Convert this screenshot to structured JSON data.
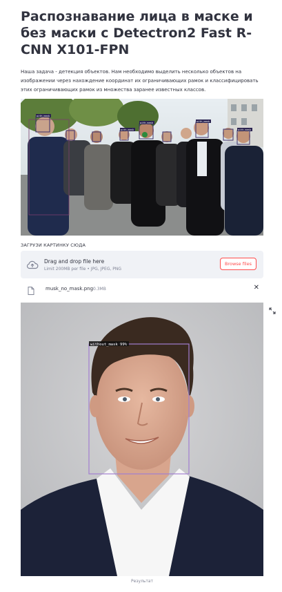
{
  "header": {
    "title": "Распознавание лица в маске и без маски с Detectron2 Fast R-CNN X101-FPN",
    "description": "Наша задача - детекция объектов. Нам необходимо выделить несколько объектов на изображении через нахождение координат их ограничивающих рамок и классифицировать этих ограничивающих рамок из множества заранее известных классов."
  },
  "crowd_image": {
    "detections": [
      "with_mask",
      "with_mask",
      "with_mask",
      "with_mask",
      "with_mask",
      "with_mask",
      "with_mask",
      "with_mask",
      "with_mask"
    ]
  },
  "uploader": {
    "label": "ЗАГРУЗИ КАРТИНКУ СЮДА",
    "drop_title": "Drag and drop file here",
    "limit_text": "Limit 200MB per file • JPG, JPEG, PNG",
    "browse_label": "Browse files",
    "icon": "cloud-upload-icon"
  },
  "file": {
    "name": "musk_no_mask.png",
    "size": "0.3MB",
    "remove_symbol": "✕",
    "icon": "file-icon"
  },
  "result_image": {
    "detection_label": "without_mask 99%",
    "box_color": "#a27fd0",
    "caption": "Результат"
  },
  "colors": {
    "accent": "#ff4b4b",
    "text": "#31333f",
    "muted": "#808495",
    "dropzone": "#f0f2f6"
  }
}
